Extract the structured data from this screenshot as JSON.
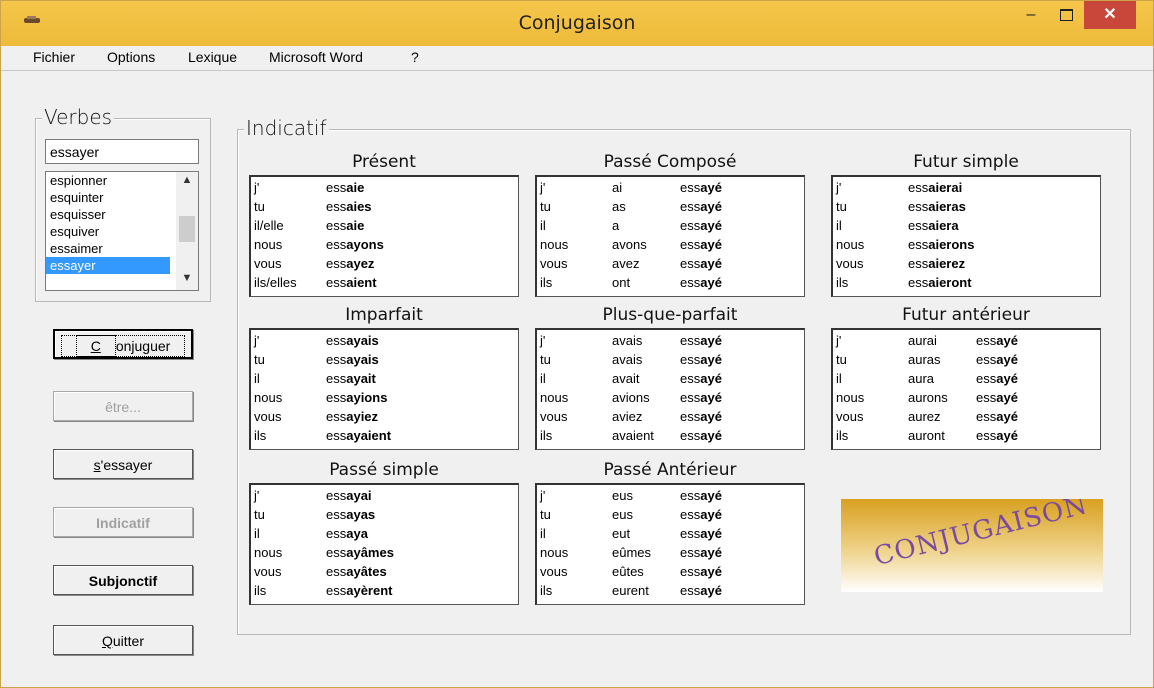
{
  "window": {
    "title": "Conjugaison",
    "minimize": "‒",
    "close": "✕"
  },
  "menu": [
    "Fichier",
    "Options",
    "Lexique",
    "Microsoft Word",
    "?"
  ],
  "verbs": {
    "title": "Verbes",
    "input_value": "essayer",
    "list": [
      "espionner",
      "esquinter",
      "esquisser",
      "esquiver",
      "essaimer",
      "essayer"
    ],
    "selected": "essayer"
  },
  "buttons": {
    "conjuguer": "Conjuguer",
    "etre": "être...",
    "sessayer": "s'essayer",
    "indicatif": "Indicatif",
    "subjonctif": "Subjonctif",
    "quitter": "Quitter"
  },
  "mood": {
    "title": "Indicatif"
  },
  "tenses": {
    "present": {
      "title": "Présent",
      "rows": [
        {
          "p": "j'",
          "stem": "ess",
          "end": "aie"
        },
        {
          "p": "tu",
          "stem": "ess",
          "end": "aies"
        },
        {
          "p": "il/elle",
          "stem": "ess",
          "end": "aie"
        },
        {
          "p": "nous",
          "stem": "ess",
          "end": "ayons"
        },
        {
          "p": "vous",
          "stem": "ess",
          "end": "ayez"
        },
        {
          "p": "ils/elles",
          "stem": "ess",
          "end": "aient"
        }
      ]
    },
    "passe_compose": {
      "title": "Passé Composé",
      "rows": [
        {
          "p": "j'",
          "aux": "ai",
          "stem": "ess",
          "end": "ayé"
        },
        {
          "p": "tu",
          "aux": "as",
          "stem": "ess",
          "end": "ayé"
        },
        {
          "p": "il",
          "aux": "a",
          "stem": "ess",
          "end": "ayé"
        },
        {
          "p": "nous",
          "aux": "avons",
          "stem": "ess",
          "end": "ayé"
        },
        {
          "p": "vous",
          "aux": "avez",
          "stem": "ess",
          "end": "ayé"
        },
        {
          "p": "ils",
          "aux": "ont",
          "stem": "ess",
          "end": "ayé"
        }
      ]
    },
    "futur_simple": {
      "title": "Futur simple",
      "rows": [
        {
          "p": "j'",
          "stem": "ess",
          "end": "aierai"
        },
        {
          "p": "tu",
          "stem": "ess",
          "end": "aieras"
        },
        {
          "p": "il",
          "stem": "ess",
          "end": "aiera"
        },
        {
          "p": "nous",
          "stem": "ess",
          "end": "aierons"
        },
        {
          "p": "vous",
          "stem": "ess",
          "end": "aierez"
        },
        {
          "p": "ils",
          "stem": "ess",
          "end": "aieront"
        }
      ]
    },
    "imparfait": {
      "title": "Imparfait",
      "rows": [
        {
          "p": "j'",
          "stem": "ess",
          "end": "ayais"
        },
        {
          "p": "tu",
          "stem": "ess",
          "end": "ayais"
        },
        {
          "p": "il",
          "stem": "ess",
          "end": "ayait"
        },
        {
          "p": "nous",
          "stem": "ess",
          "end": "ayions"
        },
        {
          "p": "vous",
          "stem": "ess",
          "end": "ayiez"
        },
        {
          "p": "ils",
          "stem": "ess",
          "end": "ayaient"
        }
      ]
    },
    "plus_que_parfait": {
      "title": "Plus-que-parfait",
      "rows": [
        {
          "p": "j'",
          "aux": "avais",
          "stem": "ess",
          "end": "ayé"
        },
        {
          "p": "tu",
          "aux": "avais",
          "stem": "ess",
          "end": "ayé"
        },
        {
          "p": "il",
          "aux": "avait",
          "stem": "ess",
          "end": "ayé"
        },
        {
          "p": "nous",
          "aux": "avions",
          "stem": "ess",
          "end": "ayé"
        },
        {
          "p": "vous",
          "aux": "aviez",
          "stem": "ess",
          "end": "ayé"
        },
        {
          "p": "ils",
          "aux": "avaient",
          "stem": "ess",
          "end": "ayé"
        }
      ]
    },
    "futur_anterieur": {
      "title": "Futur antérieur",
      "rows": [
        {
          "p": "j'",
          "aux": "aurai",
          "stem": "ess",
          "end": "ayé"
        },
        {
          "p": "tu",
          "aux": "auras",
          "stem": "ess",
          "end": "ayé"
        },
        {
          "p": "il",
          "aux": "aura",
          "stem": "ess",
          "end": "ayé"
        },
        {
          "p": "nous",
          "aux": "aurons",
          "stem": "ess",
          "end": "ayé"
        },
        {
          "p": "vous",
          "aux": "aurez",
          "stem": "ess",
          "end": "ayé"
        },
        {
          "p": "ils",
          "aux": "auront",
          "stem": "ess",
          "end": "ayé"
        }
      ]
    },
    "passe_simple": {
      "title": "Passé simple",
      "rows": [
        {
          "p": "j'",
          "stem": "ess",
          "end": "ayai"
        },
        {
          "p": "tu",
          "stem": "ess",
          "end": "ayas"
        },
        {
          "p": "il",
          "stem": "ess",
          "end": "aya"
        },
        {
          "p": "nous",
          "stem": "ess",
          "end": "ayâmes"
        },
        {
          "p": "vous",
          "stem": "ess",
          "end": "ayâtes"
        },
        {
          "p": "ils",
          "stem": "ess",
          "end": "ayèrent"
        }
      ]
    },
    "passe_anterieur": {
      "title": "Passé Antérieur",
      "rows": [
        {
          "p": "j'",
          "aux": "eus",
          "stem": "ess",
          "end": "ayé"
        },
        {
          "p": "tu",
          "aux": "eus",
          "stem": "ess",
          "end": "ayé"
        },
        {
          "p": "il",
          "aux": "eut",
          "stem": "ess",
          "end": "ayé"
        },
        {
          "p": "nous",
          "aux": "eûmes",
          "stem": "ess",
          "end": "ayé"
        },
        {
          "p": "vous",
          "aux": "eûtes",
          "stem": "ess",
          "end": "ayé"
        },
        {
          "p": "ils",
          "aux": "eurent",
          "stem": "ess",
          "end": "ayé"
        }
      ]
    }
  },
  "logo": {
    "text": "CONJUGAISON"
  },
  "colors": {
    "titlebar": "#f0c243",
    "close": "#c9473a",
    "selection": "#3399ff"
  }
}
